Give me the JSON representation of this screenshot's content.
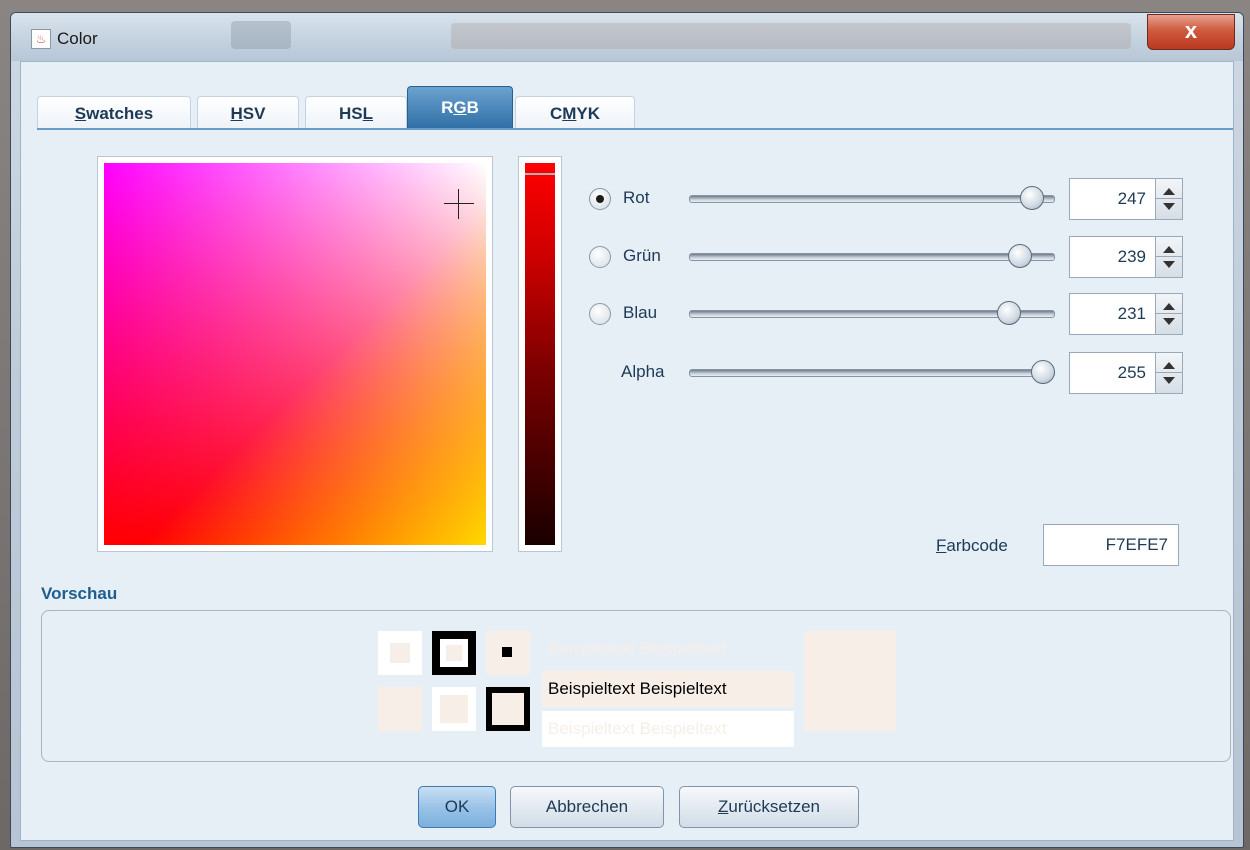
{
  "window": {
    "title": "Color",
    "close_label": "x"
  },
  "tabs": [
    {
      "label": "Swatches",
      "mnemonic_index": 0
    },
    {
      "label": "HSV",
      "mnemonic_index": 0
    },
    {
      "label": "HSL",
      "mnemonic_index": 2
    },
    {
      "label": "RGB",
      "mnemonic_index": 1
    },
    {
      "label": "CMYK",
      "mnemonic_index": 1
    }
  ],
  "active_tab": "RGB",
  "channels": [
    {
      "label": "Rot",
      "value": "247",
      "fraction": 0.9686,
      "selected": true,
      "has_radio": true
    },
    {
      "label": "Grün",
      "value": "239",
      "fraction": 0.9373,
      "selected": false,
      "has_radio": true
    },
    {
      "label": "Blau",
      "value": "231",
      "fraction": 0.9059,
      "selected": false,
      "has_radio": true
    },
    {
      "label": "Alpha",
      "value": "255",
      "fraction": 1.0,
      "selected": false,
      "has_radio": false
    }
  ],
  "farbcode": {
    "label": "Farbcode",
    "value": "F7EFE7"
  },
  "preview": {
    "title": "Vorschau",
    "sample_text": "Beispieltext  Beispieltext",
    "color": "#F7EFE7"
  },
  "buttons": {
    "ok": "OK",
    "cancel": "Abbrechen",
    "reset": "Zurücksetzen"
  }
}
